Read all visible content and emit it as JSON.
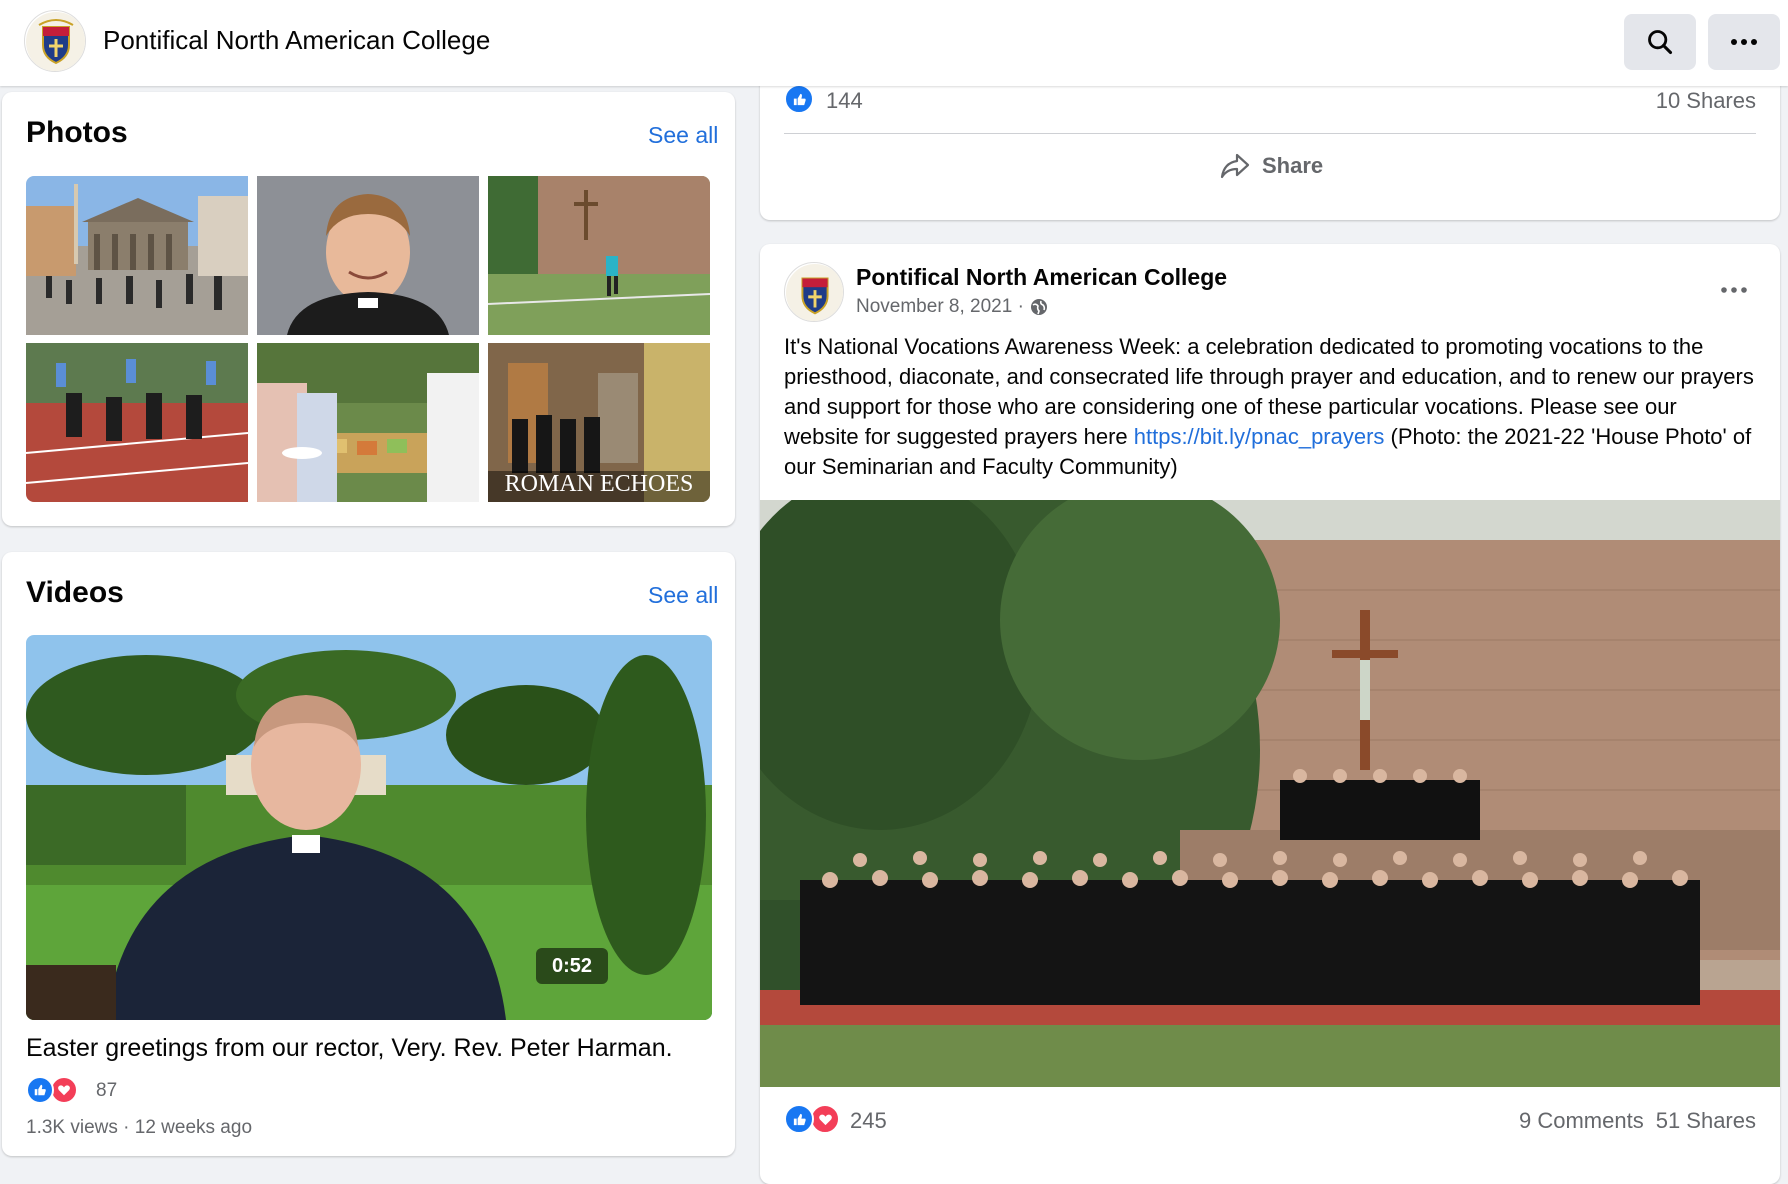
{
  "header": {
    "page_name": "Pontifical North American College"
  },
  "photos": {
    "title": "Photos",
    "see_all": "See all",
    "overlay_text": "ROMAN ECHOES"
  },
  "videos": {
    "title": "Videos",
    "see_all": "See all",
    "duration": "0:52",
    "caption": "Easter greetings from our rector, Very. Rev. Peter Harman.",
    "reactions": "87",
    "views_meta": "1.3K views · 12 weeks ago"
  },
  "prev_post": {
    "likes": "144",
    "shares": "10 Shares",
    "share_label": "Share"
  },
  "post": {
    "author": "Pontifical North American College",
    "date": "November 8, 2021 ·",
    "text_before_link": "It's National Vocations Awareness Week: a celebration dedicated to promoting vocations to the priesthood, diaconate, and consecrated life through prayer and education, and to renew our prayers and support for those who are considering one of these particular vocations. Please see our website for suggested prayers here ",
    "link": "https://bit.ly/pnac_prayers",
    "text_after_link": " (Photo: the 2021-22 'House Photo' of our Seminarian and Faculty Community)",
    "reactions": "245",
    "comments": "9 Comments",
    "shares": "51 Shares"
  },
  "colors": {
    "link": "#216fdb",
    "like_blue": "#1877f2",
    "love_red": "#f33e58",
    "muted": "#65676b"
  }
}
